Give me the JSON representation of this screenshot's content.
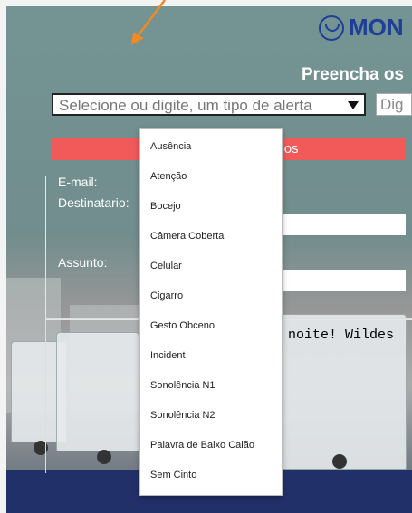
{
  "brand": {
    "name": "MON"
  },
  "heading": "Preencha os",
  "alert_select": {
    "placeholder": "Selecione ou digite, um tipo de alerta"
  },
  "second_input": {
    "value": "Dig"
  },
  "send_bar": {
    "label": "pos"
  },
  "form": {
    "email_label": "E-mail:",
    "destinatario_label": "Destinatario:",
    "assunto_label": "Assunto:"
  },
  "message_preview": "a noite! Wildes",
  "dropdown": {
    "options": [
      "Ausência",
      "Atenção",
      "Bocejo",
      "Câmera Coberta",
      "Celular",
      "Cigarro",
      "Gesto Obceno",
      "Incident",
      "Sonolência N1",
      "Sonolência N2",
      "Palavra de Baixo Calão",
      "Sem Cinto"
    ]
  },
  "colors": {
    "annotation_arrow": "#f08a24",
    "send_bar": "#f25a5a",
    "brand": "#1f3f96",
    "footer": "#22306a"
  }
}
